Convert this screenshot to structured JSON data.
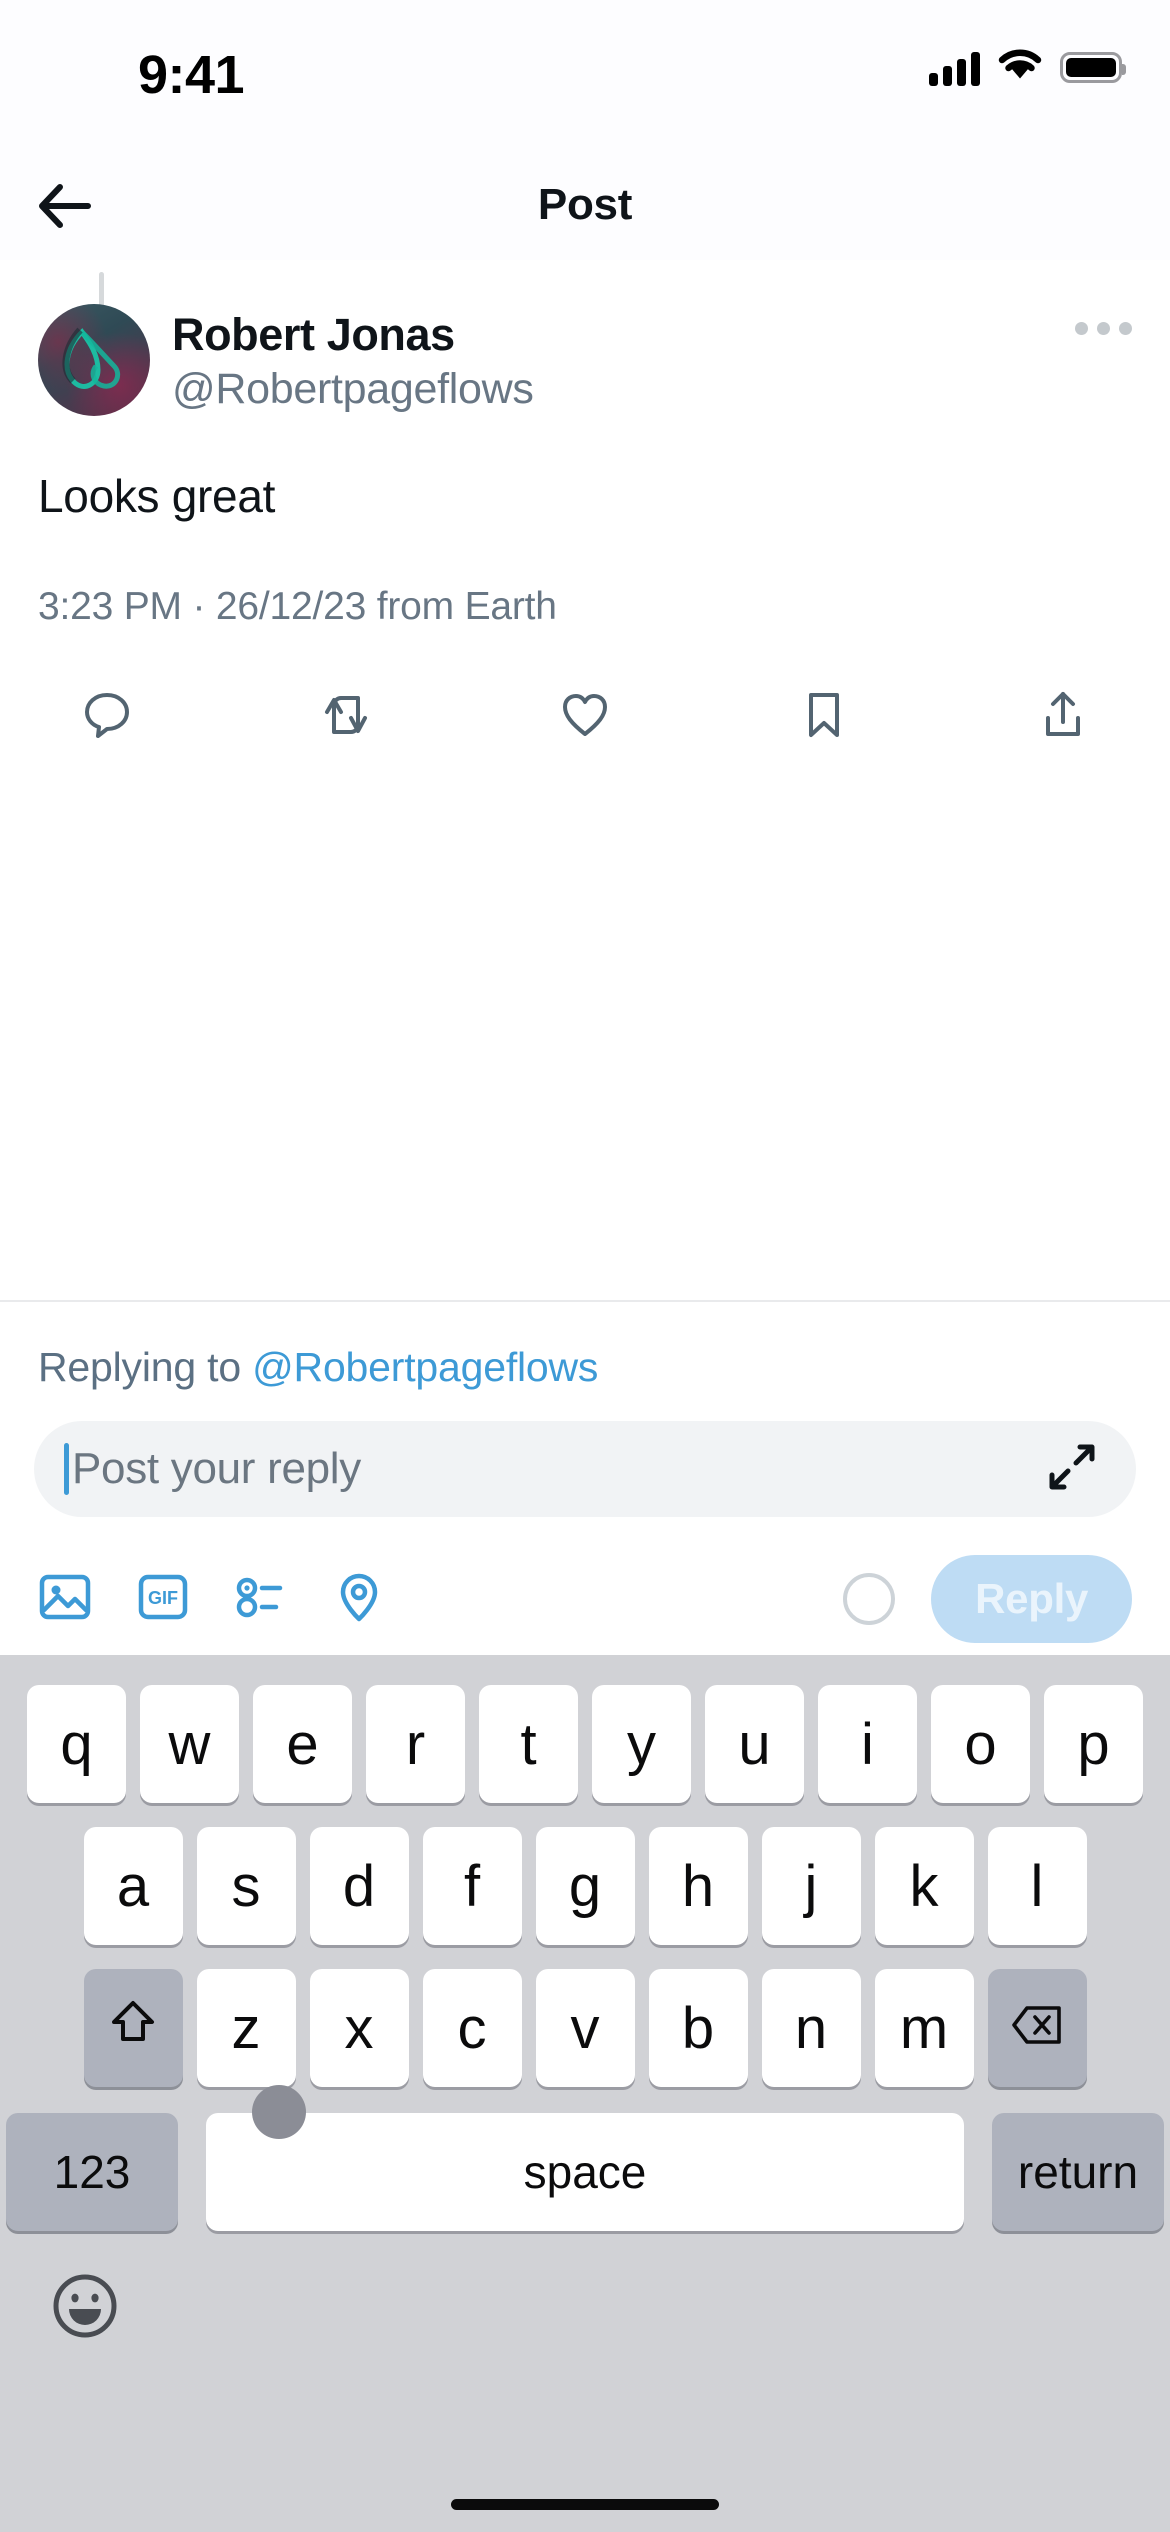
{
  "status_bar": {
    "time": "9:41",
    "signal_icon": "cellular-signal-icon",
    "wifi_icon": "wifi-icon",
    "battery_icon": "battery-icon"
  },
  "nav": {
    "back_icon": "back-arrow-icon",
    "title": "Post"
  },
  "post": {
    "display_name": "Robert Jonas",
    "handle": "@Robertpageflows",
    "text": "Looks great",
    "meta": "3:23 PM · 26/12/23 from Earth",
    "more_icon": "more-options-icon",
    "avatar_alt": "avatar",
    "actions": [
      {
        "name": "reply-action",
        "icon": "comment-icon"
      },
      {
        "name": "repost-action",
        "icon": "repost-icon"
      },
      {
        "name": "like-action",
        "icon": "heart-icon"
      },
      {
        "name": "bookmark-action",
        "icon": "bookmark-icon"
      },
      {
        "name": "share-action",
        "icon": "share-icon"
      }
    ]
  },
  "composer": {
    "replying_prefix": "Replying to ",
    "replying_handle": "@Robertpageflows",
    "placeholder": "Post your reply",
    "input_value": "",
    "expand_icon": "expand-icon",
    "tools": [
      {
        "name": "media-button",
        "icon": "image-icon",
        "label": ""
      },
      {
        "name": "gif-button",
        "icon": "gif-icon",
        "label": "GIF"
      },
      {
        "name": "poll-button",
        "icon": "poll-icon",
        "label": ""
      },
      {
        "name": "location-button",
        "icon": "location-pin-icon",
        "label": ""
      }
    ],
    "char_count_icon": "character-count-circle",
    "submit_label": "Reply"
  },
  "keyboard": {
    "row1": [
      "q",
      "w",
      "e",
      "r",
      "t",
      "y",
      "u",
      "i",
      "o",
      "p"
    ],
    "row2": [
      "a",
      "s",
      "d",
      "f",
      "g",
      "h",
      "j",
      "k",
      "l"
    ],
    "row3": [
      "z",
      "x",
      "c",
      "v",
      "b",
      "n",
      "m"
    ],
    "shift_icon": "shift-icon",
    "backspace_icon": "backspace-icon",
    "numeric_label": "123",
    "space_label": "space",
    "return_label": "return",
    "emoji_icon": "emoji-icon"
  },
  "colors": {
    "accent_blue": "#3d9ad6",
    "link_blue": "#3d9ad6",
    "text_primary": "#0f1419",
    "text_secondary": "#687684",
    "keyboard_bg": "#d1d2d6",
    "reply_button_bg": "#bedcf4"
  }
}
